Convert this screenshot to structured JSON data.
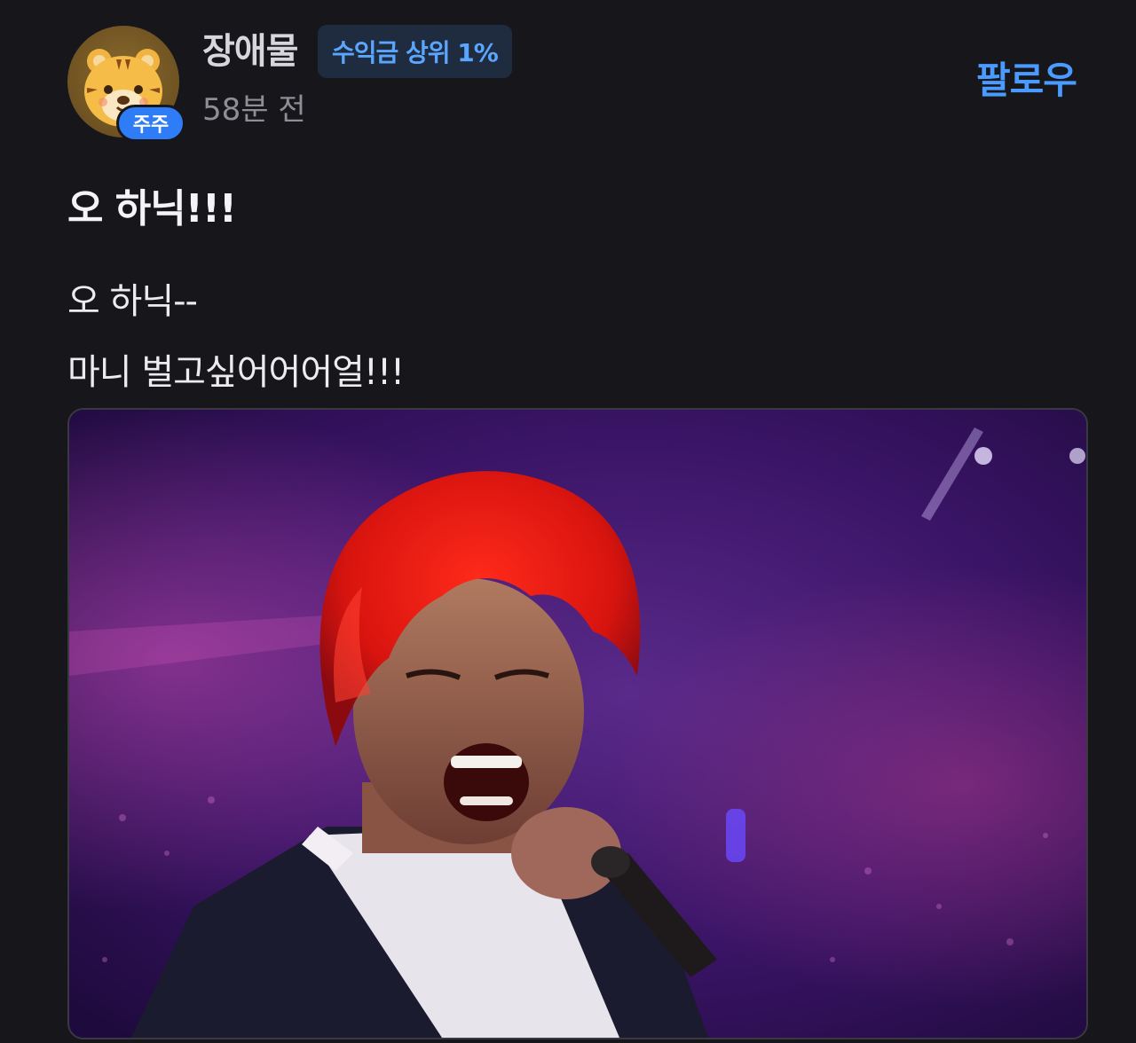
{
  "author": {
    "name": "장애물",
    "rank_badge": "수익금 상위 1%",
    "avatar_badge": "주주",
    "avatar_icon": "tiger-face-icon"
  },
  "post": {
    "timestamp": "58분 전",
    "follow_label": "팔로우",
    "title": "오 하닉!!!",
    "body_lines": [
      "오 하닉--",
      "마니 벌고싶어어어얼!!!"
    ]
  },
  "colors": {
    "background": "#17161b",
    "accent": "#4a9bff",
    "badge_bg": "#1f2b3e",
    "zuju_badge": "#2e7cf6"
  },
  "image": {
    "subject_icon": "singer-with-red-hair-image"
  }
}
